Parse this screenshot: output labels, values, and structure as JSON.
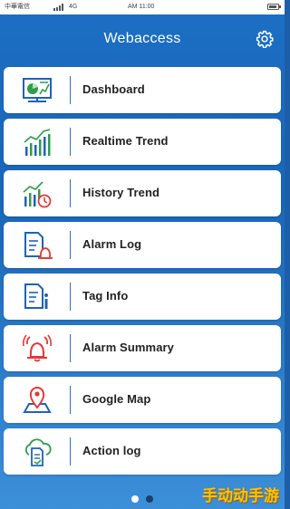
{
  "status_bar": {
    "carrier": "中華電信",
    "network": "4G",
    "time": "AM 11:00"
  },
  "header": {
    "title": "Webaccess",
    "settings_icon": "gear-icon"
  },
  "menu": {
    "items": [
      {
        "label": "Dashboard",
        "icon": "dashboard-icon"
      },
      {
        "label": "Realtime Trend",
        "icon": "realtime-trend-icon"
      },
      {
        "label": "History Trend",
        "icon": "history-trend-icon"
      },
      {
        "label": "Alarm Log",
        "icon": "alarm-log-icon"
      },
      {
        "label": "Tag Info",
        "icon": "tag-info-icon"
      },
      {
        "label": "Alarm Summary",
        "icon": "alarm-bell-icon"
      },
      {
        "label": "Google Map",
        "icon": "map-pin-icon"
      },
      {
        "label": "Action log",
        "icon": "action-log-icon"
      }
    ]
  },
  "pager": {
    "pages": 2,
    "current": 1
  },
  "watermark": "手动动手游",
  "colors": {
    "accent_blue": "#1f63b5",
    "icon_green": "#2e9e4a",
    "icon_red": "#e53935",
    "background": "#1b6fc4"
  }
}
